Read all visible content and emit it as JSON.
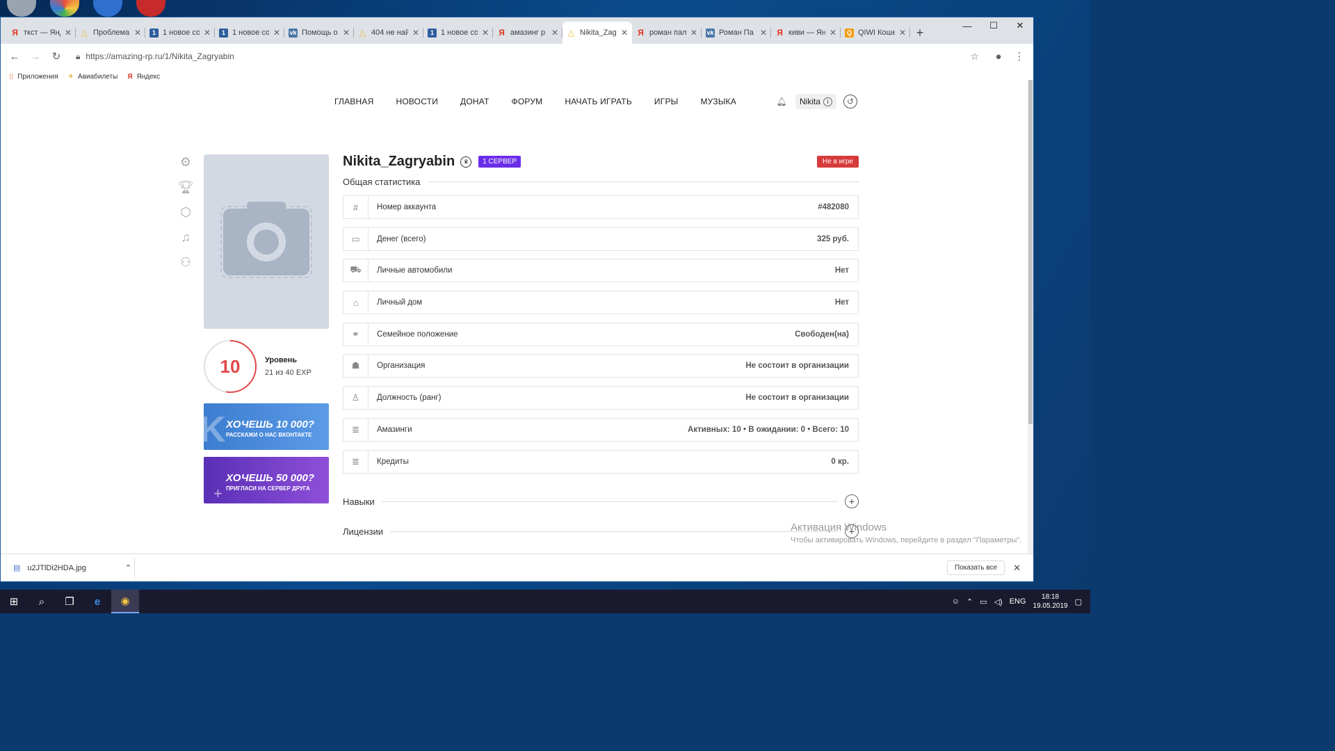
{
  "browser": {
    "tabs": [
      {
        "title": "ткст — Янд",
        "fav": "Я",
        "color": "#e0341e",
        "active": false
      },
      {
        "title": "Проблема",
        "fav": "△",
        "color": "#f1b92a",
        "active": false
      },
      {
        "title": "1 новое со",
        "fav": "1",
        "color": "#2e5d9e",
        "active": false
      },
      {
        "title": "1 новое со",
        "fav": "1",
        "color": "#2e5d9e",
        "active": false
      },
      {
        "title": "Помощь о",
        "fav": "vk",
        "color": "#4a76a8",
        "active": false
      },
      {
        "title": "404 не най",
        "fav": "△",
        "color": "#f1b92a",
        "active": false
      },
      {
        "title": "1 новое со",
        "fav": "1",
        "color": "#2e5d9e",
        "active": false
      },
      {
        "title": "амазинг р",
        "fav": "Я",
        "color": "#e0341e",
        "active": false
      },
      {
        "title": "Nikita_Zag",
        "fav": "△",
        "color": "#f1b92a",
        "active": true
      },
      {
        "title": "роман пал",
        "fav": "Я",
        "color": "#e0341e",
        "active": false
      },
      {
        "title": "Роман Па",
        "fav": "vk",
        "color": "#4a76a8",
        "active": false
      },
      {
        "title": "киви — Ян",
        "fav": "Я",
        "color": "#e0341e",
        "active": false
      },
      {
        "title": "QIWI Коше",
        "fav": "Q",
        "color": "#f39c12",
        "active": false
      }
    ],
    "url": "https://amazing-rp.ru/1/Nikita_Zagryabin",
    "bookmarks": [
      "Приложения",
      "Авиабилеты",
      "Яндекс"
    ]
  },
  "site": {
    "nav": [
      "ГЛАВНАЯ",
      "НОВОСТИ",
      "ДОНАТ",
      "ФОРУМ",
      "НАЧАТЬ ИГРАТЬ",
      "ИГРЫ",
      "МУЗЫКА"
    ],
    "user_name": "Nikita"
  },
  "profile": {
    "name": "Nikita_Zagryabin",
    "server": "1 СЕРВЕР",
    "status": "Не в игре",
    "section_general": "Общая статистика",
    "level": "10",
    "level_fraction": 0.525,
    "level_label": "Уровень",
    "level_exp": "21 из 40 EXP",
    "banner1_big": "ХОЧЕШЬ 10 000?",
    "banner1_small": "РАССКАЖИ О НАС ВКОНТАКТЕ",
    "banner2_big": "ХОЧЕШЬ 50 000?",
    "banner2_small": "ПРИГЛАСИ НА СЕРВЕР ДРУГА",
    "stats": [
      {
        "icon": "hash-icon",
        "glyph": "#",
        "label": "Номер аккаунта",
        "value": "#482080"
      },
      {
        "icon": "wallet-icon",
        "glyph": "▭",
        "label": "Денег (всего)",
        "value": "325 руб."
      },
      {
        "icon": "car-icon",
        "glyph": "⛟",
        "label": "Личные автомобили",
        "value": "Нет"
      },
      {
        "icon": "house-icon",
        "glyph": "⌂",
        "label": "Личный дом",
        "value": "Нет"
      },
      {
        "icon": "couple-icon",
        "glyph": "⚭",
        "label": "Семейное положение",
        "value": "Свободен(на)"
      },
      {
        "icon": "group-icon",
        "glyph": "☗",
        "label": "Организация",
        "value": "Не состоит в организации"
      },
      {
        "icon": "person-icon",
        "glyph": "♙",
        "label": "Должность (ранг)",
        "value": "Не состоит в организации"
      },
      {
        "icon": "coins-icon",
        "glyph": "≣",
        "label": "Амазинги",
        "value": "Активных: 10  •  В ожидании: 0  •  Всего: 10"
      },
      {
        "icon": "coins-icon",
        "glyph": "≣",
        "label": "Кредиты",
        "value": "0 кр."
      }
    ],
    "section_skills": "Навыки",
    "section_licenses": "Лицензии"
  },
  "watermark": {
    "line1": "Активация Windows",
    "line2": "Чтобы активировать Windows, перейдите в раздел \"Параметры\"."
  },
  "downloads": {
    "file": "u2JTlDi2HDA.jpg",
    "show_all": "Показать все"
  },
  "taskbar": {
    "lang": "ENG",
    "time": "18:18",
    "date": "19.05.2019"
  }
}
